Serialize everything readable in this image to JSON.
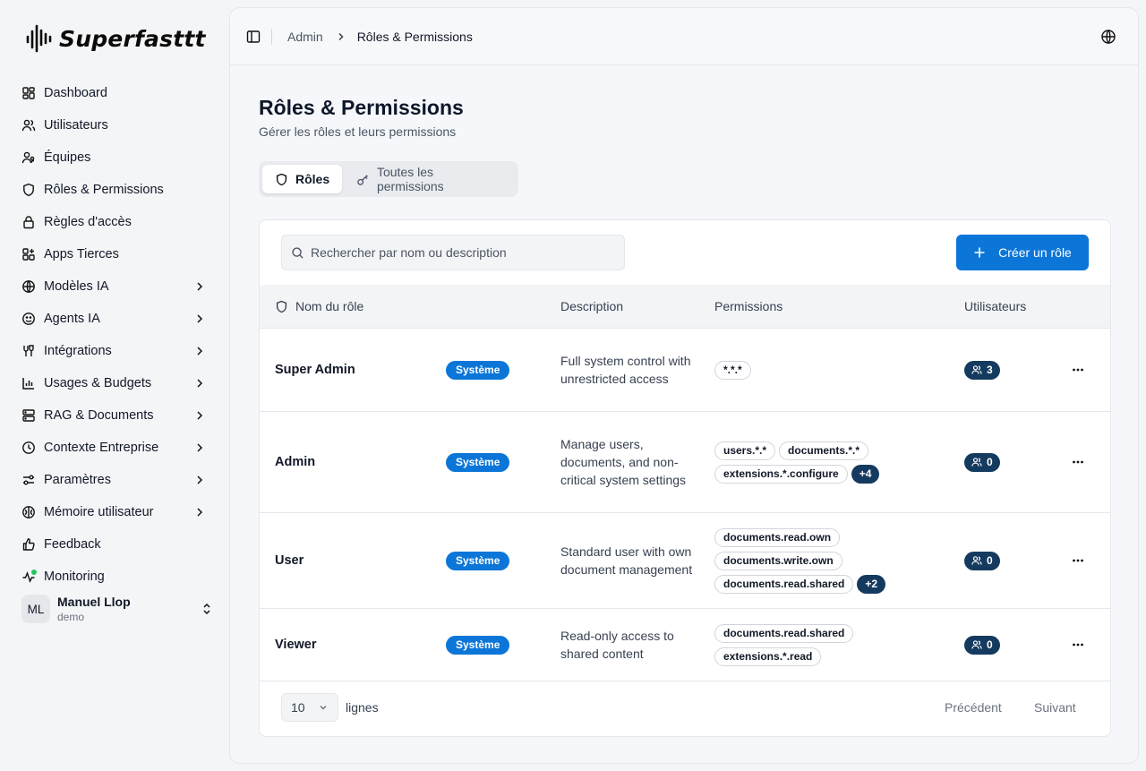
{
  "app": {
    "name": "Superfasttt"
  },
  "sidebar": {
    "items": [
      {
        "label": "Dashboard",
        "icon": "dashboard-grid-icon",
        "has_children": false
      },
      {
        "label": "Utilisateurs",
        "icon": "users-icon",
        "has_children": false
      },
      {
        "label": "Équipes",
        "icon": "team-icon",
        "has_children": false
      },
      {
        "label": "Rôles & Permissions",
        "icon": "shield-icon",
        "has_children": false
      },
      {
        "label": "Règles d'accès",
        "icon": "lock-icon",
        "has_children": false
      },
      {
        "label": "Apps Tierces",
        "icon": "apps-icon",
        "has_children": false
      },
      {
        "label": "Modèles IA",
        "icon": "globe-icon",
        "has_children": true
      },
      {
        "label": "Agents IA",
        "icon": "bot-icon",
        "has_children": true
      },
      {
        "label": "Intégrations",
        "icon": "plug-icon",
        "has_children": true
      },
      {
        "label": "Usages & Budgets",
        "icon": "bar-chart-icon",
        "has_children": true
      },
      {
        "label": "RAG & Documents",
        "icon": "database-icon",
        "has_children": true
      },
      {
        "label": "Contexte Entreprise",
        "icon": "building-icon",
        "has_children": true
      },
      {
        "label": "Paramètres",
        "icon": "sliders-icon",
        "has_children": true
      },
      {
        "label": "Mémoire utilisateur",
        "icon": "brain-icon",
        "has_children": true
      },
      {
        "label": "Feedback",
        "icon": "thumbs-up-icon",
        "has_children": false
      },
      {
        "label": "Monitoring",
        "icon": "activity-icon",
        "has_children": false
      }
    ],
    "user": {
      "initials": "ML",
      "name": "Manuel Llop",
      "org": "demo"
    }
  },
  "breadcrumb": {
    "root": "Admin",
    "current": "Rôles & Permissions"
  },
  "page": {
    "title": "Rôles & Permissions",
    "subtitle": "Gérer les rôles et leurs permissions"
  },
  "tabs": [
    {
      "label": "Rôles",
      "active": true
    },
    {
      "label": "Toutes les permissions",
      "active": false
    }
  ],
  "search": {
    "placeholder": "Rechercher par nom ou description",
    "value": ""
  },
  "create_button": {
    "label": "Créer un rôle"
  },
  "table": {
    "columns": {
      "name": "Nom du rôle",
      "description": "Description",
      "permissions": "Permissions",
      "users": "Utilisateurs"
    },
    "rows": [
      {
        "name": "Super Admin",
        "badge": "Système",
        "description": "Full system control with unrestricted access",
        "permissions": [
          "*.*.*"
        ],
        "more": "",
        "users": "3"
      },
      {
        "name": "Admin",
        "badge": "Système",
        "description": "Manage users, documents, and non-critical system settings",
        "permissions": [
          "users.*.*",
          "documents.*.*",
          "extensions.*.configure"
        ],
        "more": "+4",
        "users": "0"
      },
      {
        "name": "User",
        "badge": "Système",
        "description": "Standard user with own document management",
        "permissions": [
          "documents.read.own",
          "documents.write.own",
          "documents.read.shared"
        ],
        "more": "+2",
        "users": "0"
      },
      {
        "name": "Viewer",
        "badge": "Système",
        "description": "Read-only access to shared content",
        "permissions": [
          "documents.read.shared",
          "extensions.*.read"
        ],
        "more": "",
        "users": "0"
      }
    ]
  },
  "pagination": {
    "page_size": "10",
    "page_size_label": "lignes",
    "prev": "Précédent",
    "next": "Suivant"
  },
  "colors": {
    "primary": "#0b76d8",
    "dark_badge": "#153a5f",
    "monitoring_status": "#22c55e"
  }
}
